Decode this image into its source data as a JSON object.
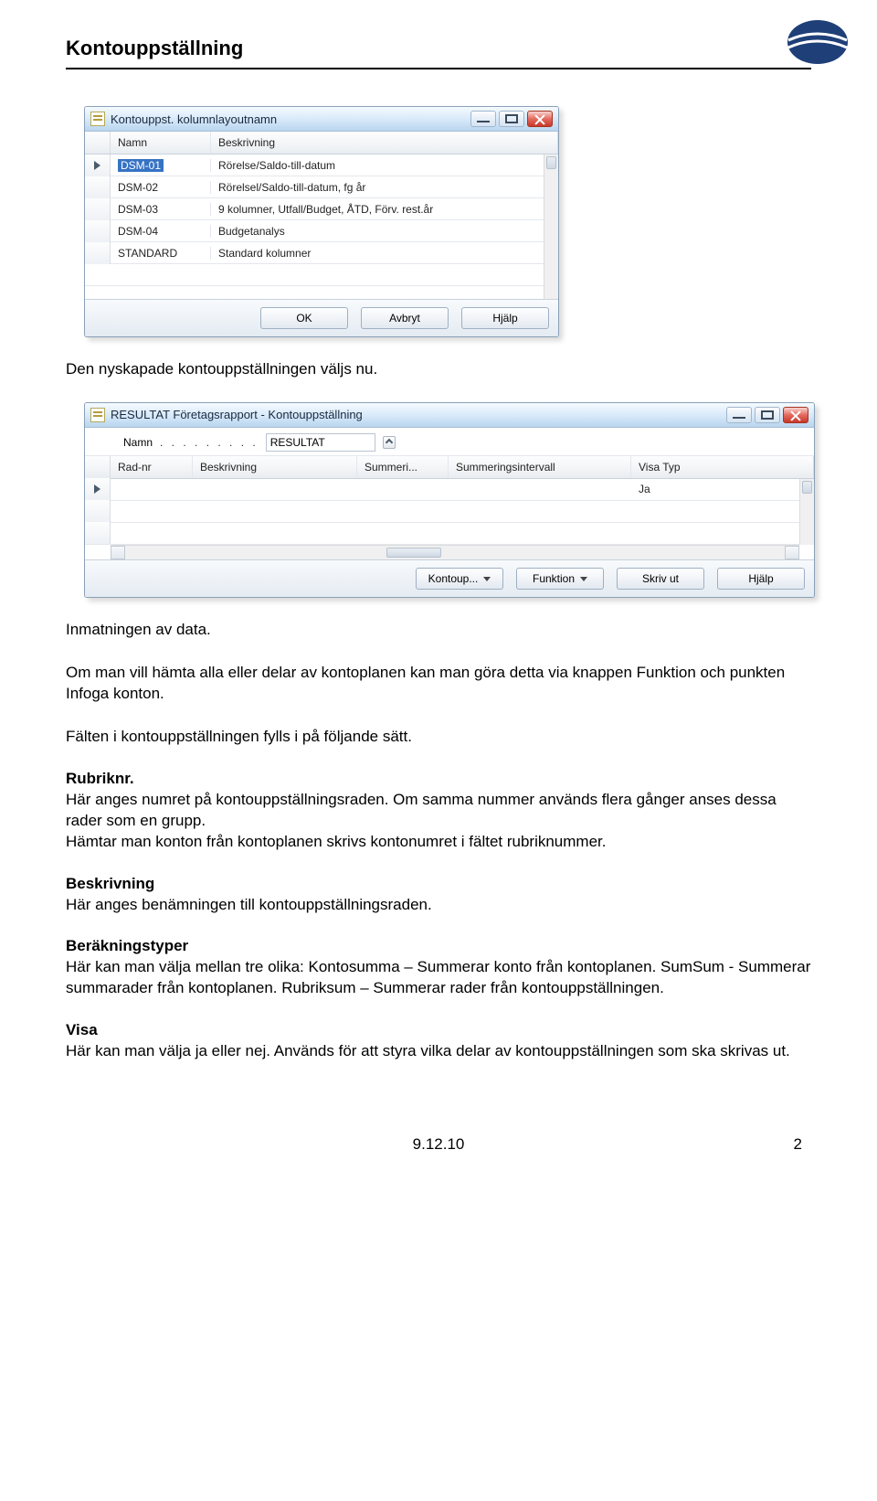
{
  "page_title": "Kontouppställning",
  "win1": {
    "title": "Kontouppst. kolumnlayoutnamn",
    "columns": [
      "Namn",
      "Beskrivning"
    ],
    "rows": [
      {
        "name": "DSM-01",
        "desc": "Rörelse/Saldo-till-datum",
        "selected": true,
        "current": true
      },
      {
        "name": "DSM-02",
        "desc": "Rörelsel/Saldo-till-datum, fg år"
      },
      {
        "name": "DSM-03",
        "desc": "9 kolumner, Utfall/Budget, ÅTD, Förv. rest.år"
      },
      {
        "name": "DSM-04",
        "desc": "Budgetanalys"
      },
      {
        "name": "STANDARD",
        "desc": "Standard kolumner"
      }
    ],
    "buttons": {
      "ok": "OK",
      "cancel": "Avbryt",
      "help": "Hjälp"
    }
  },
  "para1": "Den nyskapade kontouppställningen väljs nu.",
  "win2": {
    "title": "RESULTAT Företagsrapport - Kontouppställning",
    "form": {
      "name_label": "Namn",
      "name_value": "RESULTAT"
    },
    "columns": [
      "Rad-nr",
      "Beskrivning",
      "Summeri...",
      "Summeringsintervall",
      "Visa Typ"
    ],
    "row_visa_value": "Ja",
    "buttons": {
      "kontoup": "Kontoup...",
      "funktion": "Funktion",
      "skrivut": "Skriv ut",
      "help": "Hjälp"
    }
  },
  "para2": "Inmatningen av data.",
  "para3": "Om man vill hämta alla eller delar av kontoplanen kan man göra detta via knappen Funktion och punkten Infoga konton.",
  "para4": "Fälten i kontouppställningen fylls i på följande sätt.",
  "sec1_head": "Rubriknr.",
  "sec1_body": "Här anges numret på kontouppställningsraden. Om samma nummer används flera gånger anses dessa rader som en grupp.\nHämtar man konton från kontoplanen skrivs kontonumret i fältet rubriknummer.",
  "sec2_head": "Beskrivning",
  "sec2_body": "Här anges benämningen till kontouppställningsraden.",
  "sec3_head": "Beräkningstyper",
  "sec3_body": "Här kan man välja mellan tre olika: Kontosumma – Summerar konto från kontoplanen. SumSum - Summerar summarader från kontoplanen. Rubriksum – Summerar rader från kontouppställningen.",
  "sec4_head": "Visa",
  "sec4_body": "Här kan man välja ja eller nej. Används för att styra vilka delar av kontouppställningen som ska skrivas ut.",
  "footer_date": "9.12.10",
  "footer_page": "2"
}
